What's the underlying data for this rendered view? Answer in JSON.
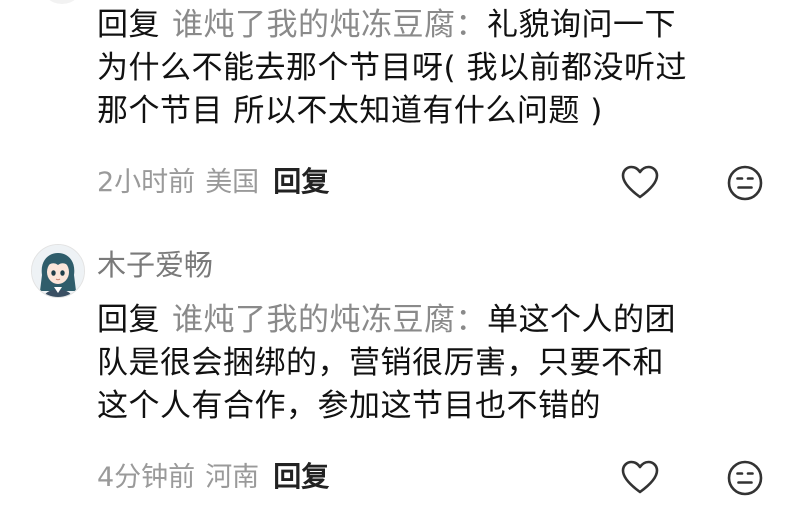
{
  "comments": [
    {
      "reply_prefix": "回复",
      "reply_target": "谁炖了我的炖冻豆腐：",
      "lines": [
        "礼貌询问一下",
        "为什么不能去那个节目呀( 我以前都没听过",
        "那个节目 所以不太知道有什么问题 )"
      ],
      "time": "2小时前",
      "location": "美国",
      "reply_label": "回复",
      "like_icon": "heart-outline-icon",
      "dislike_icon": "neutral-face-icon"
    },
    {
      "username": "木子爱畅",
      "avatar": "anime-girl-avatar",
      "reply_prefix": "回复",
      "reply_target": "谁炖了我的炖冻豆腐：",
      "lines": [
        "单这个人的团",
        "队是很会捆绑的，营销很厉害，只要不和",
        "这个人有合作，参加这节目也不错的"
      ],
      "time": "4分钟前",
      "location": "河南",
      "reply_label": "回复",
      "like_icon": "heart-outline-icon",
      "dislike_icon": "neutral-face-icon"
    }
  ],
  "colors": {
    "text": "#111111",
    "muted": "#9a9a9a",
    "reply_target": "#8a8a8a",
    "username": "#7a7a7a",
    "icon": "#333333"
  }
}
